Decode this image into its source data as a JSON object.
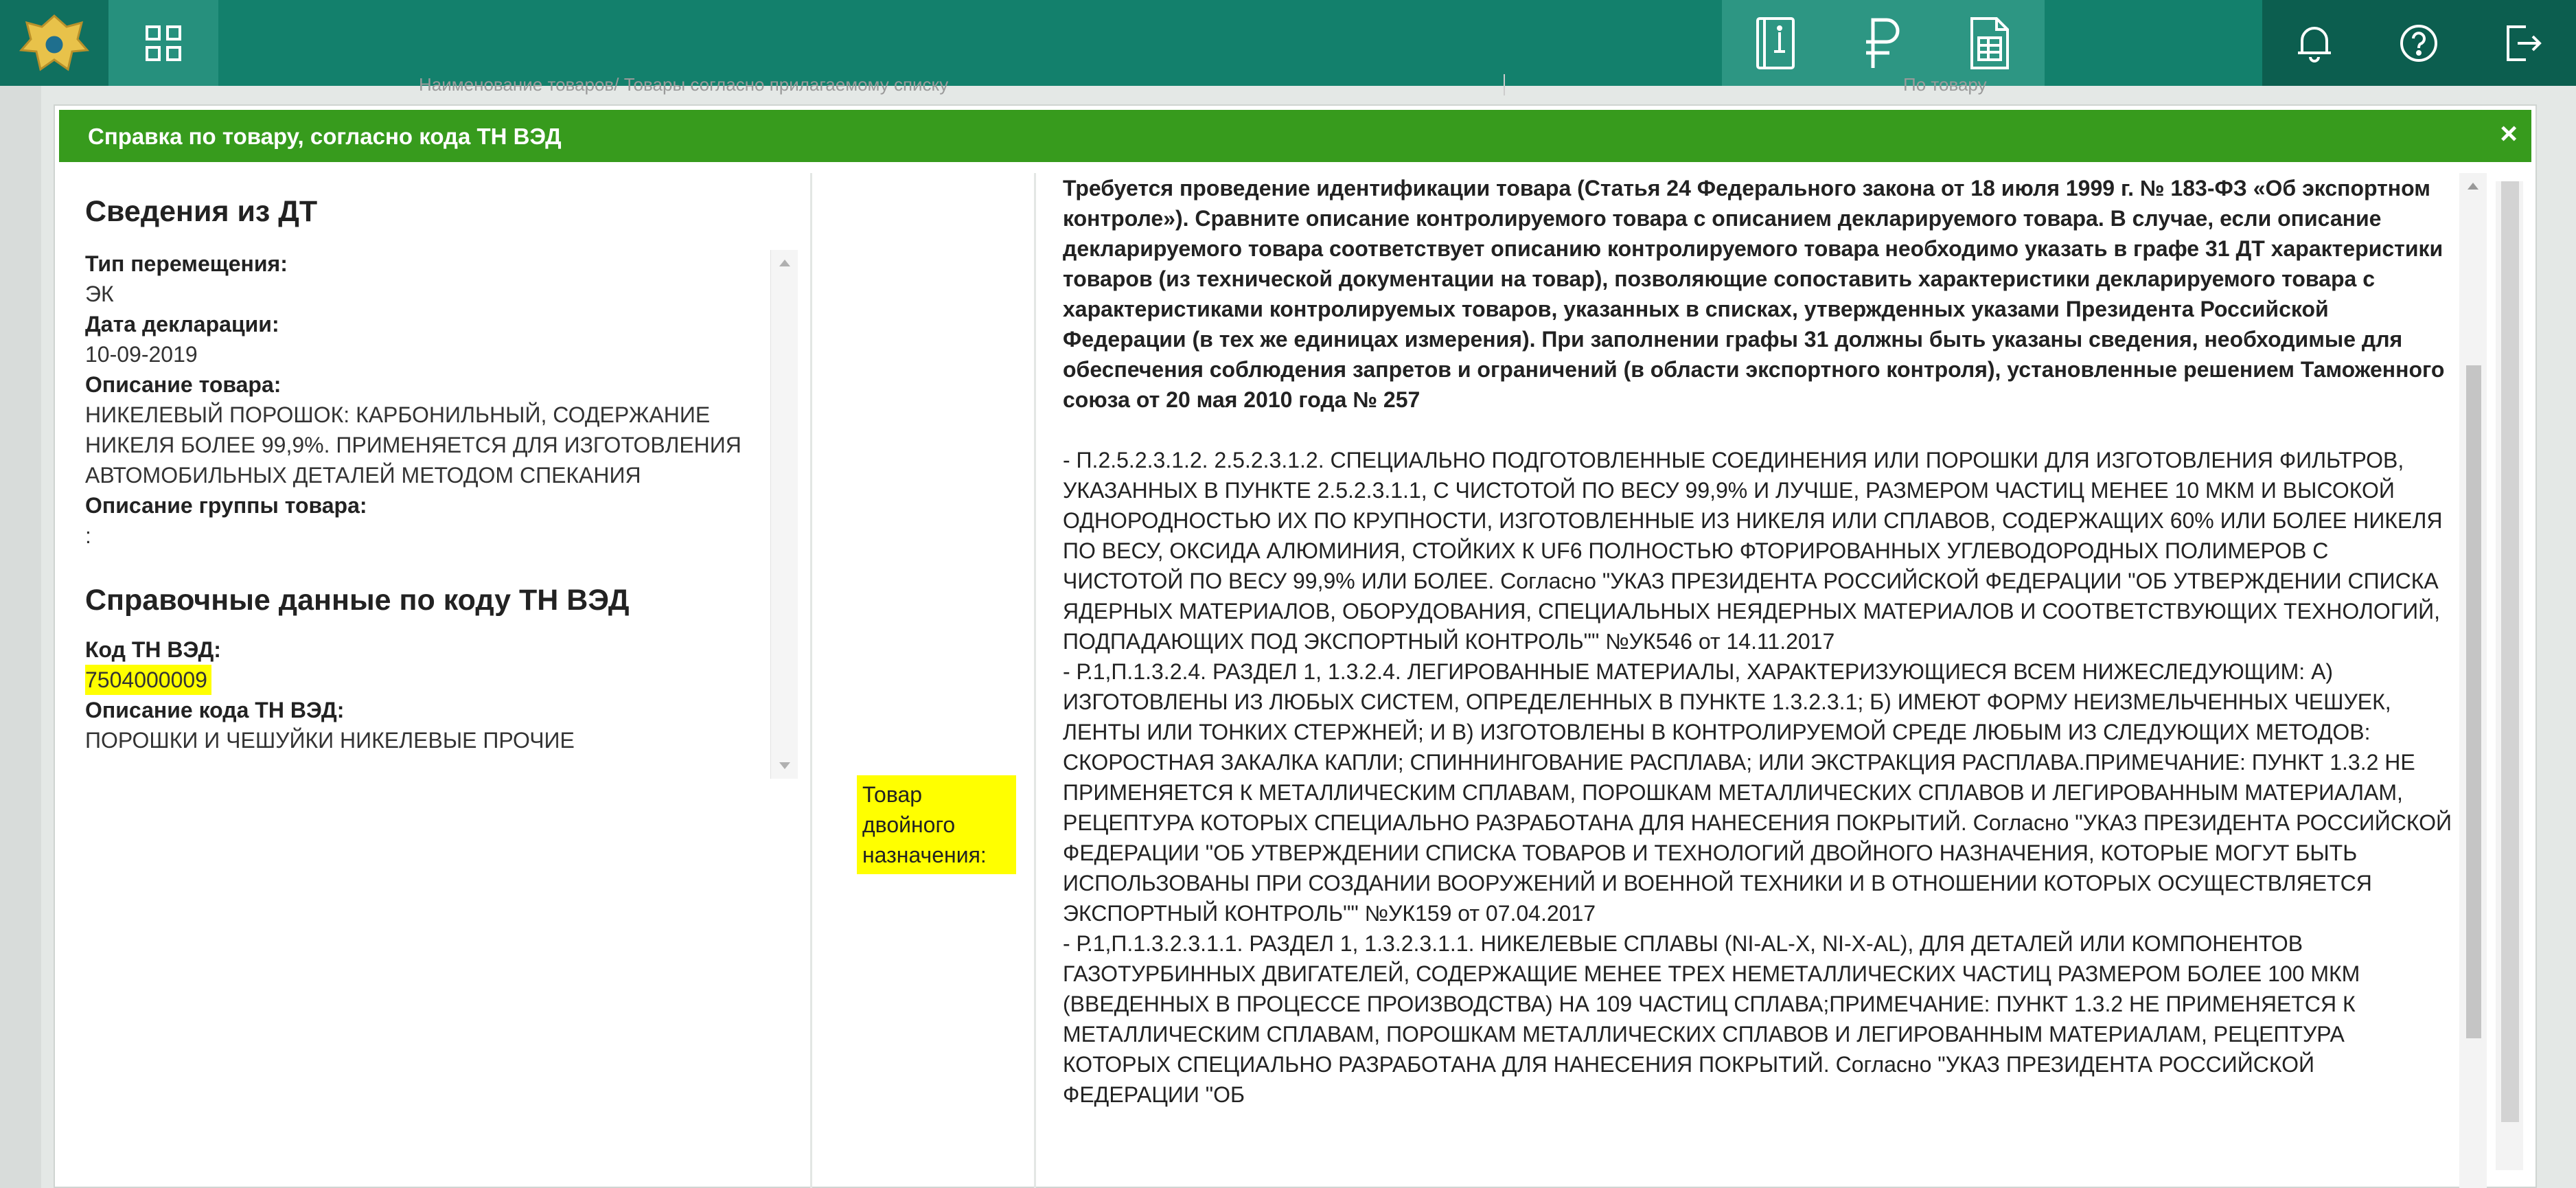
{
  "header": {
    "logo_icon": "emblem-icon",
    "apps_icon": "grid-icon",
    "center_icons": [
      "book-icon",
      "ruble-icon",
      "document-icon"
    ],
    "right_icons": [
      "notification-icon",
      "help-icon",
      "logout-icon"
    ],
    "colors": {
      "bar": "#13806c",
      "dark": "#0c5e4f",
      "light": "#2d9683"
    }
  },
  "background": {
    "row_col1": "Наименование товаров/ Товары согласно прилагаемому списку",
    "row_col2": "По товару"
  },
  "modal": {
    "title": "Справка по товару, согласно кода ТН ВЭД",
    "close": "×",
    "header_color": "#379b1d",
    "dt_section_title": "Сведения из ДТ",
    "fields": {
      "move_type_label": "Тип перемещения:",
      "move_type_value": "ЭК",
      "decl_date_label": "Дата декларации:",
      "decl_date_value": "10-09-2019",
      "goods_desc_label": "Описание товара:",
      "goods_desc_value": "НИКЕЛЕВЫЙ ПОРОШОК: КАРБОНИЛЬНЫЙ, СОДЕРЖАНИЕ НИКЕЛЯ БОЛЕЕ 99,9%. ПРИМЕНЯЕТСЯ ДЛЯ ИЗГОТОВЛЕНИЯ АВТОМОБИЛЬНЫХ ДЕТАЛЕЙ МЕТОДОМ СПЕКАНИЯ",
      "group_desc_label": "Описание группы товара:",
      "group_desc_value": ":"
    },
    "ref_section_title": "Справочные данные по коду ТН ВЭД",
    "ref": {
      "code_label": "Код ТН ВЭД:",
      "code_value": "7504000009",
      "code_desc_label": "Описание кода ТН ВЭД:",
      "code_desc_value": "ПОРОШКИ И ЧЕШУЙКИ НИКЕЛЕВЫЕ ПРОЧИЕ"
    },
    "dual_use_badge": "Товар двойного назначения:",
    "highlight_color": "#ffff00",
    "notice_bold": "Требуется проведение идентификации товара (Статья 24 Федерального закона от 18 июля 1999 г. № 183-ФЗ «Об экспортном контроле»). Сравните описание контролируемого товара с описанием декларируемого товара. В случае, если описание декларируемого товара соответствует описанию контролируемого товара необходимо указать в графе 31 ДТ характеристики товаров (из технической документации на товар), позволяющие сопоставить характеристики декларируемого товара с характеристиками контролируемых товаров, указанных в списках, утвержденных указами Президента Российской Федерации (в тех же единицах измерения). При заполнении графы 31 должны быть указаны сведения, необходимые для обеспечения соблюдения запретов и ограничений (в области экспортного контроля), установленные решением Таможенного союза от 20 мая 2010 года № 257",
    "items": [
      "- П.2.5.2.3.1.2. 2.5.2.3.1.2. СПЕЦИАЛЬНО ПОДГОТОВЛЕННЫЕ СОЕДИНЕНИЯ ИЛИ ПОРОШКИ ДЛЯ ИЗГОТОВЛЕНИЯ ФИЛЬТРОВ, УКАЗАННЫХ В ПУНКТЕ 2.5.2.3.1.1, С ЧИСТОТОЙ ПО ВЕСУ 99,9% И ЛУЧШЕ, РАЗМЕРОМ ЧАСТИЦ МЕНЕЕ 10 МКМ И ВЫСОКОЙ ОДНОРОДНОСТЬЮ ИХ ПО КРУПНОСТИ, ИЗГОТОВЛЕННЫЕ ИЗ НИКЕЛЯ ИЛИ СПЛАВОВ, СОДЕРЖАЩИХ 60% ИЛИ БОЛЕЕ НИКЕЛЯ ПО ВЕСУ, ОКСИДА АЛЮМИНИЯ, СТОЙКИХ К UF6 ПОЛНОСТЬЮ ФТОРИРОВАННЫХ УГЛЕВОДОРОДНЫХ ПОЛИМЕРОВ С ЧИСТОТОЙ ПО ВЕСУ 99,9% ИЛИ БОЛЕЕ. Согласно \"УКАЗ ПРЕЗИДЕНТА РОССИЙСКОЙ ФЕДЕРАЦИИ \"ОБ УТВЕРЖДЕНИИ СПИСКА ЯДЕРНЫХ МАТЕРИАЛОВ, ОБОРУДОВАНИЯ, СПЕЦИАЛЬНЫХ НЕЯДЕРНЫХ МАТЕРИАЛОВ И СООТВЕТСТВУЮЩИХ ТЕХНОЛОГИЙ, ПОДПАДАЮЩИХ ПОД ЭКСПОРТНЫЙ КОНТРОЛЬ\"\" №УК546 от 14.11.2017",
      "- Р.1,П.1.3.2.4. РАЗДЕЛ 1, 1.3.2.4. ЛЕГИРОВАННЫЕ МАТЕРИАЛЫ, ХАРАКТЕРИЗУЮЩИЕСЯ ВСЕМ НИЖЕСЛЕДУЮЩИМ: А) ИЗГОТОВЛЕНЫ ИЗ ЛЮБЫХ СИСТЕМ, ОПРЕДЕЛЕННЫХ В ПУНКТЕ 1.3.2.3.1; Б) ИМЕЮТ ФОРМУ НЕИЗМЕЛЬЧЕННЫХ ЧЕШУЕК, ЛЕНТЫ ИЛИ ТОНКИХ СТЕРЖНЕЙ; И В) ИЗГОТОВЛЕНЫ В КОНТРОЛИРУЕМОЙ СРЕДЕ ЛЮБЫМ ИЗ СЛЕДУЮЩИХ МЕТОДОВ: СКОРОСТНАЯ ЗАКАЛКА КАПЛИ; СПИННИНГОВАНИЕ РАСПЛАВА; ИЛИ ЭКСТРАКЦИЯ РАСПЛАВА.ПРИМЕЧАНИЕ: ПУНКТ 1.3.2 НЕ ПРИМЕНЯЕТСЯ К МЕТАЛЛИЧЕСКИМ СПЛАВАМ, ПОРОШКАМ МЕТАЛЛИЧЕСКИХ СПЛАВОВ И ЛЕГИРОВАННЫМ МАТЕРИАЛАМ, РЕЦЕПТУРА КОТОРЫХ СПЕЦИАЛЬНО РАЗРАБОТАНА ДЛЯ НАНЕСЕНИЯ ПОКРЫТИЙ. Согласно \"УКАЗ ПРЕЗИДЕНТА РОССИЙСКОЙ ФЕДЕРАЦИИ \"ОБ УТВЕРЖДЕНИИ СПИСКА ТОВАРОВ И ТЕХНОЛОГИЙ ДВОЙНОГО НАЗНАЧЕНИЯ, КОТОРЫЕ МОГУТ БЫТЬ ИСПОЛЬЗОВАНЫ ПРИ СОЗДАНИИ ВООРУЖЕНИЙ И ВОЕННОЙ ТЕХНИКИ И В ОТНОШЕНИИ КОТОРЫХ ОСУЩЕСТВЛЯЕТСЯ ЭКСПОРТНЫЙ КОНТРОЛЬ\"\" №УК159 от 07.04.2017",
      "- Р.1,П.1.3.2.3.1.1. РАЗДЕЛ 1, 1.3.2.3.1.1. НИКЕЛЕВЫЕ СПЛАВЫ (NI-AL-X, NI-X-AL), ДЛЯ ДЕТАЛЕЙ ИЛИ КОМПОНЕНТОВ ГАЗОТУРБИННЫХ ДВИГАТЕЛЕЙ, СОДЕРЖАЩИЕ МЕНЕЕ ТРЕХ НЕМЕТАЛЛИЧЕСКИХ ЧАСТИЦ РАЗМЕРОМ БОЛЕЕ 100 МКМ (ВВЕДЕННЫХ В ПРОЦЕССЕ ПРОИЗВОДСТВА) НА 109 ЧАСТИЦ СПЛАВА;ПРИМЕЧАНИЕ: ПУНКТ 1.3.2 НЕ ПРИМЕНЯЕТСЯ К МЕТАЛЛИЧЕСКИМ СПЛАВАМ, ПОРОШКАМ МЕТАЛЛИЧЕСКИХ СПЛАВОВ И ЛЕГИРОВАННЫМ МАТЕРИАЛАМ, РЕЦЕПТУРА КОТОРЫХ СПЕЦИАЛЬНО РАЗРАБОТАНА ДЛЯ НАНЕСЕНИЯ ПОКРЫТИЙ. Согласно \"УКАЗ ПРЕЗИДЕНТА РОССИЙСКОЙ ФЕДЕРАЦИИ \"ОБ"
    ]
  }
}
